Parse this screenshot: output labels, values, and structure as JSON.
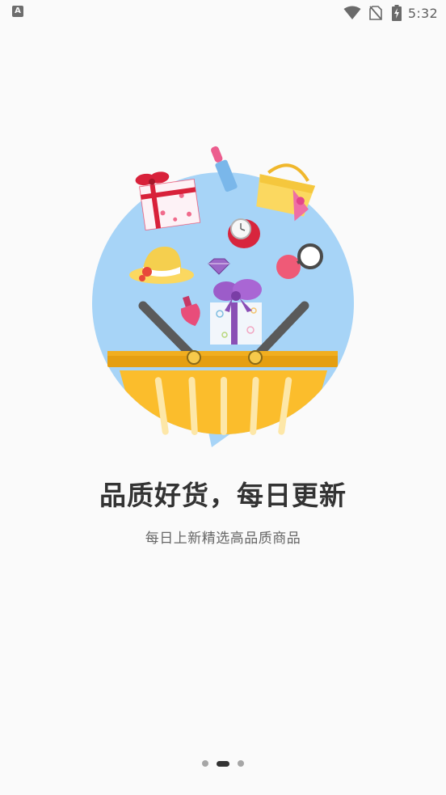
{
  "status_bar": {
    "notification_icon": "A",
    "icons": [
      "wifi-icon",
      "no-sim-icon",
      "battery-charging-icon"
    ],
    "time": "5:32"
  },
  "onboarding": {
    "title": "品质好货，每日更新",
    "subtitle": "每日上新精选高品质商品",
    "illustration": "shopping-basket-with-gifts",
    "page_count": 3,
    "active_page": 2
  },
  "colors": {
    "background": "#fafafa",
    "circle": "#a7d4f7",
    "basket": "#fbbd2c",
    "basket_rim": "#e59f12",
    "handle": "#5a5a5a",
    "title": "#333333",
    "subtitle": "#666666"
  }
}
